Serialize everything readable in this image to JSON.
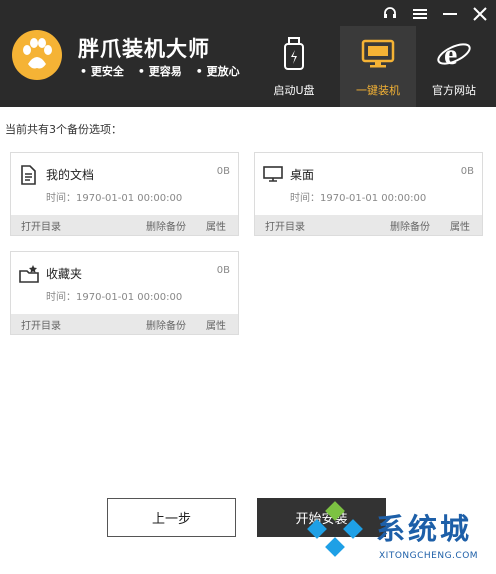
{
  "header": {
    "app_title": "胖爪装机大师",
    "taglines": [
      "更安全",
      "更容易",
      "更放心"
    ],
    "nav": [
      {
        "label": "启动U盘",
        "icon": "usb-drive-icon",
        "active": false
      },
      {
        "label": "一键装机",
        "icon": "monitor-icon",
        "active": true
      },
      {
        "label": "官方网站",
        "icon": "ie-browser-icon",
        "active": false
      }
    ],
    "colors": {
      "bg": "#2b2b2b",
      "accent": "#f5b335"
    }
  },
  "content": {
    "summary": "当前共有3个备份选项：",
    "backups": [
      {
        "name": "我的文档",
        "size": "0B",
        "time": "时间：1970-01-01 00:00:00",
        "icon": "document-icon",
        "open": "打开目录",
        "delete": "删除备份",
        "props": "属性"
      },
      {
        "name": "桌面",
        "size": "0B",
        "time": "时间：1970-01-01 00:00:00",
        "icon": "desktop-icon",
        "open": "打开目录",
        "delete": "删除备份",
        "props": "属性"
      },
      {
        "name": "收藏夹",
        "size": "0B",
        "time": "时间：1970-01-01 00:00:00",
        "icon": "favorites-folder-icon",
        "open": "打开目录",
        "delete": "删除备份",
        "props": "属性"
      }
    ]
  },
  "footer": {
    "prev_label": "上一步",
    "start_label": "开始安装"
  },
  "watermark": {
    "text": "系统城",
    "sub": "XITONGCHENG.COM"
  }
}
